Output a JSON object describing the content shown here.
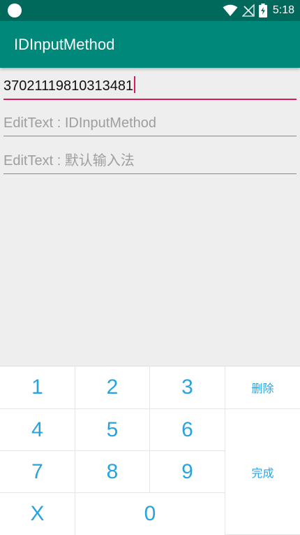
{
  "status_bar": {
    "time": "5:18",
    "icons": [
      "notification-circle-icon",
      "wifi-icon",
      "no-signal-icon",
      "battery-charging-icon"
    ]
  },
  "app_bar": {
    "title": "IDInputMethod"
  },
  "fields": {
    "id_input": {
      "value": "37021119810313481"
    },
    "edit_idinput": {
      "hint": "EditText : IDInputMethod"
    },
    "edit_default": {
      "hint": "EditText : 默认输入法"
    }
  },
  "keyboard": {
    "k1": "1",
    "k2": "2",
    "k3": "3",
    "k4": "4",
    "k5": "5",
    "k6": "6",
    "k7": "7",
    "k8": "8",
    "k9": "9",
    "kx": "X",
    "k0": "0",
    "delete": "删除",
    "done": "完成",
    "key_color": "#29a3e0"
  },
  "colors": {
    "status_bar": "#00695c",
    "app_bar": "#00897b",
    "accent": "#d81b60"
  }
}
